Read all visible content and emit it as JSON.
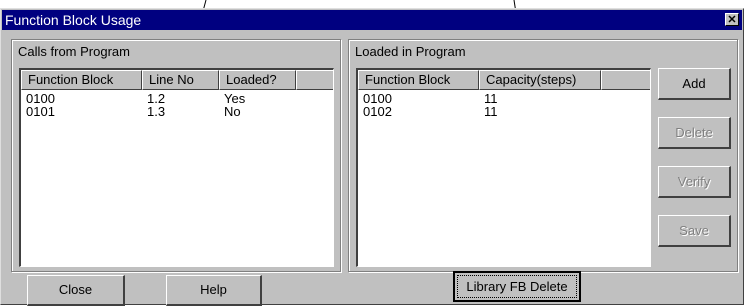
{
  "window": {
    "title": "Function Block Usage"
  },
  "left_group": {
    "label": "Calls from Program",
    "columns": [
      "Function Block",
      "Line No",
      "Loaded?"
    ],
    "rows": [
      [
        "0100",
        "1.2",
        "Yes"
      ],
      [
        "0101",
        "1.3",
        "No"
      ]
    ]
  },
  "right_group": {
    "label": "Loaded in Program",
    "columns": [
      "Function Block",
      "Capacity(steps)"
    ],
    "rows": [
      [
        "0100",
        "11"
      ],
      [
        "0102",
        "11"
      ]
    ]
  },
  "side_buttons": {
    "add": "Add",
    "delete": "Delete",
    "verify": "Verify",
    "save": "Save"
  },
  "bottom_buttons": {
    "close": "Close",
    "help": "Help",
    "library_fb_delete": "Library FB Delete"
  },
  "colors": {
    "titlebar": "#000080",
    "face": "#c0c0c0"
  }
}
